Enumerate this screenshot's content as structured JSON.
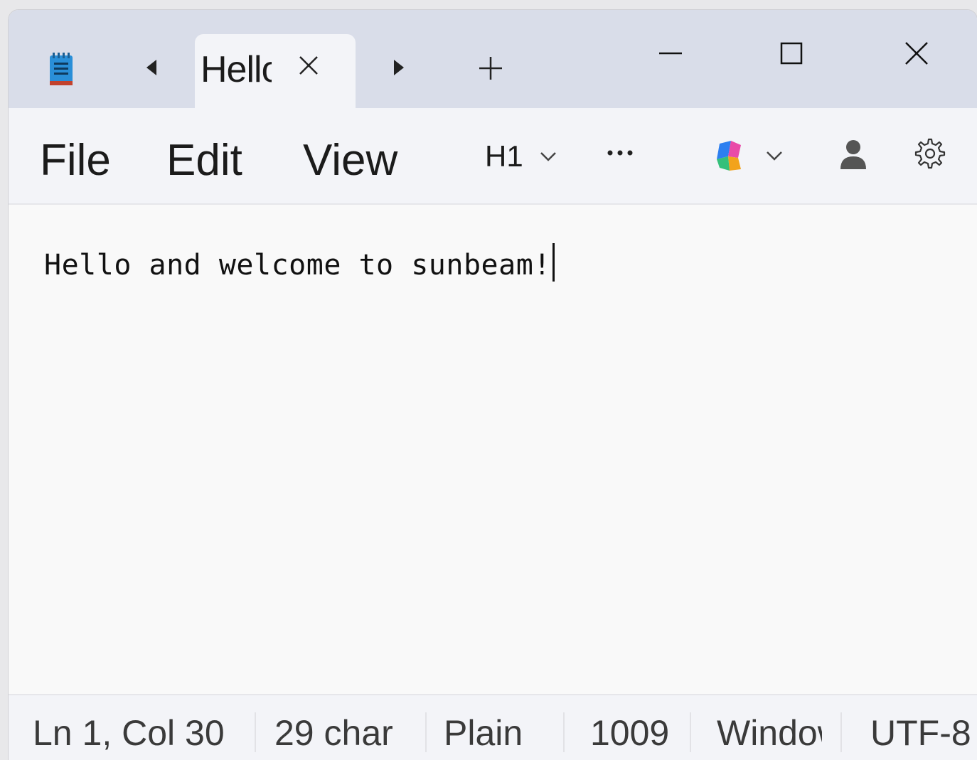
{
  "tab": {
    "title": "Hello"
  },
  "menu": {
    "file": "File",
    "edit": "Edit",
    "view": "View"
  },
  "toolbar": {
    "heading": "H1"
  },
  "editor": {
    "content": "Hello and welcome to sunbeam!"
  },
  "status": {
    "position": "Ln 1, Col 30",
    "chars": "29 char",
    "format": "Plain",
    "zoom": "1009",
    "line_ending": "Windows",
    "encoding": "UTF-8"
  },
  "colors": {
    "titlebar": "#d9dde9",
    "menubar": "#f3f4f8",
    "editor": "#f9f9f9"
  },
  "icons": {
    "app": "notepad-icon",
    "copilot": "copilot-icon",
    "account": "account-icon",
    "settings": "gear-icon"
  }
}
